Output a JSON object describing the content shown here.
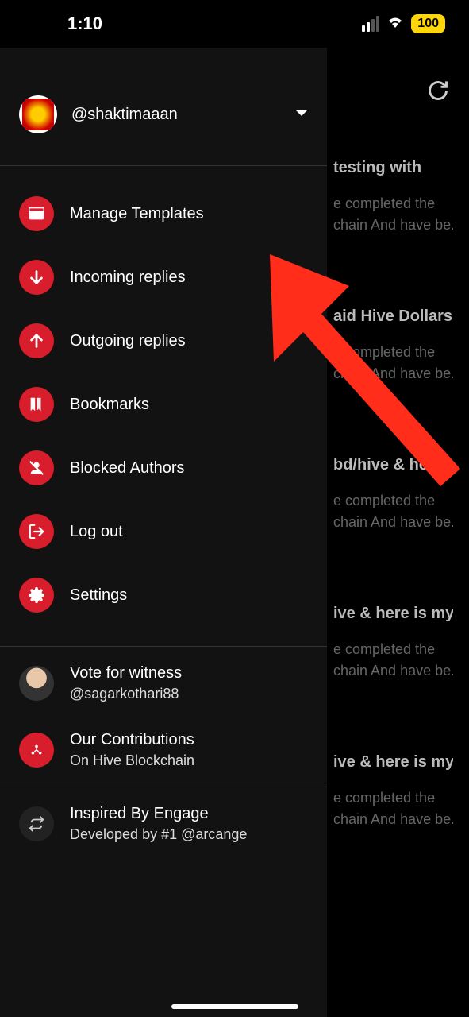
{
  "status": {
    "time": "1:10",
    "battery": "100"
  },
  "user": {
    "handle": "@shaktimaaan"
  },
  "menu": {
    "templates": "Manage Templates",
    "incoming": "Incoming replies",
    "outgoing": "Outgoing replies",
    "bookmarks": "Bookmarks",
    "blocked": "Blocked Authors",
    "logout": "Log out",
    "settings": "Settings"
  },
  "info": {
    "witness_title": "Vote for witness",
    "witness_sub": "@sagarkothari88",
    "contrib_title": "Our Contributions",
    "contrib_sub": "On Hive Blockchain",
    "inspired_title": "Inspired By Engage",
    "inspired_sub": "Developed by #1 @arcange"
  },
  "bg_posts": [
    {
      "title": "testing with",
      "body1": "e completed the",
      "body2": "chain And have be..."
    },
    {
      "title": "aid Hive Dollars &",
      "body1": "e completed the",
      "body2": "chain And have be..."
    },
    {
      "title": "bd/hive & here is",
      "body1": "e completed the",
      "body2": "chain And have be..."
    },
    {
      "title": "ive & here is my",
      "body1": "e completed the",
      "body2": "chain And have be..."
    },
    {
      "title": "ive & here is my",
      "body1": "e completed the",
      "body2": "chain And have be..."
    }
  ]
}
